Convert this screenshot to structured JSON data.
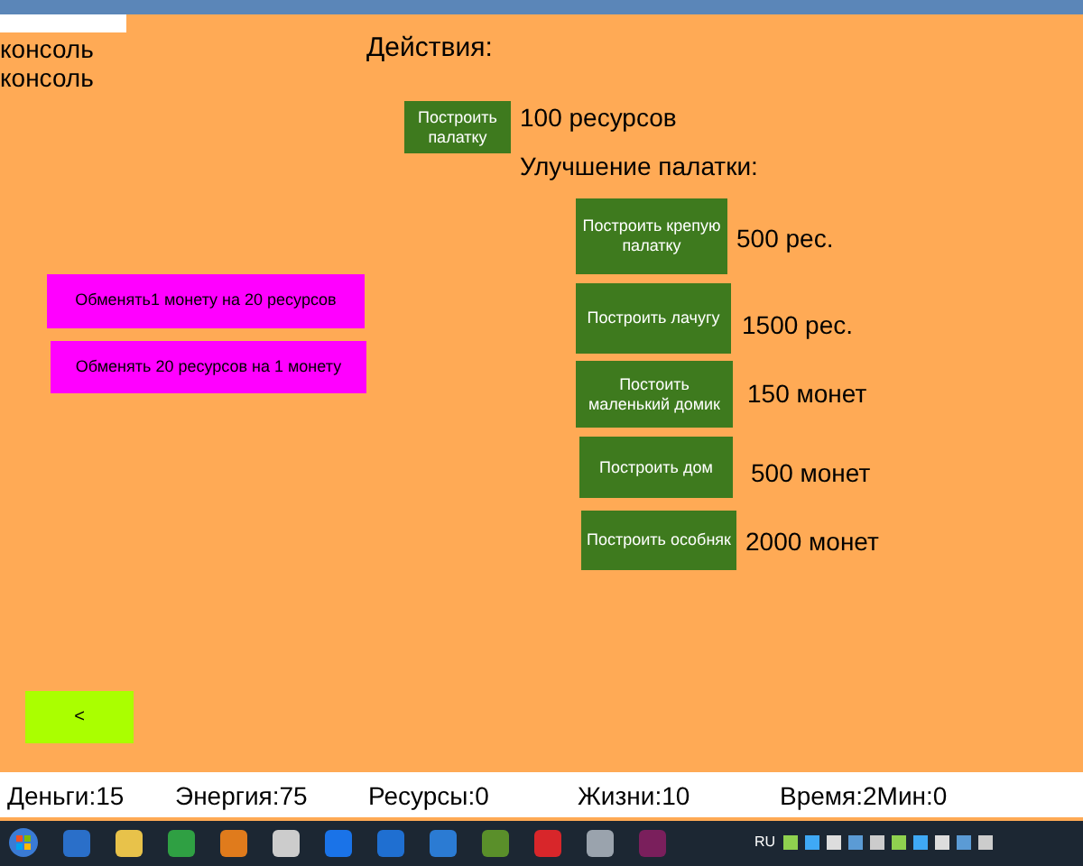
{
  "console": [
    "консоль",
    "консоль"
  ],
  "actions_title": "Действия:",
  "tent": {
    "button": "Построить палатку",
    "cost": "100 ресурсов"
  },
  "upgrade_title": "Улучшение палатки:",
  "upgrades": [
    {
      "button": "Построить крепую палатку",
      "cost": "500 рес."
    },
    {
      "button": "Построить лачугу",
      "cost": "1500 рес."
    },
    {
      "button": "Постоить маленький домик",
      "cost": "150 монет"
    },
    {
      "button": "Построить дом",
      "cost": "500 монет"
    },
    {
      "button": "Построить особняк",
      "cost": "2000 монет"
    }
  ],
  "exchange": [
    "Обменять1 монету на 20 ресурсов",
    "Обменять 20 ресурсов на 1 монету"
  ],
  "back_button": "<",
  "status_bar": [
    "Деньги:15",
    "Энергия:75",
    "Ресурсы:0",
    "Жизни:10",
    "Время:2Мин:0"
  ],
  "taskbar": {
    "language": "RU"
  }
}
